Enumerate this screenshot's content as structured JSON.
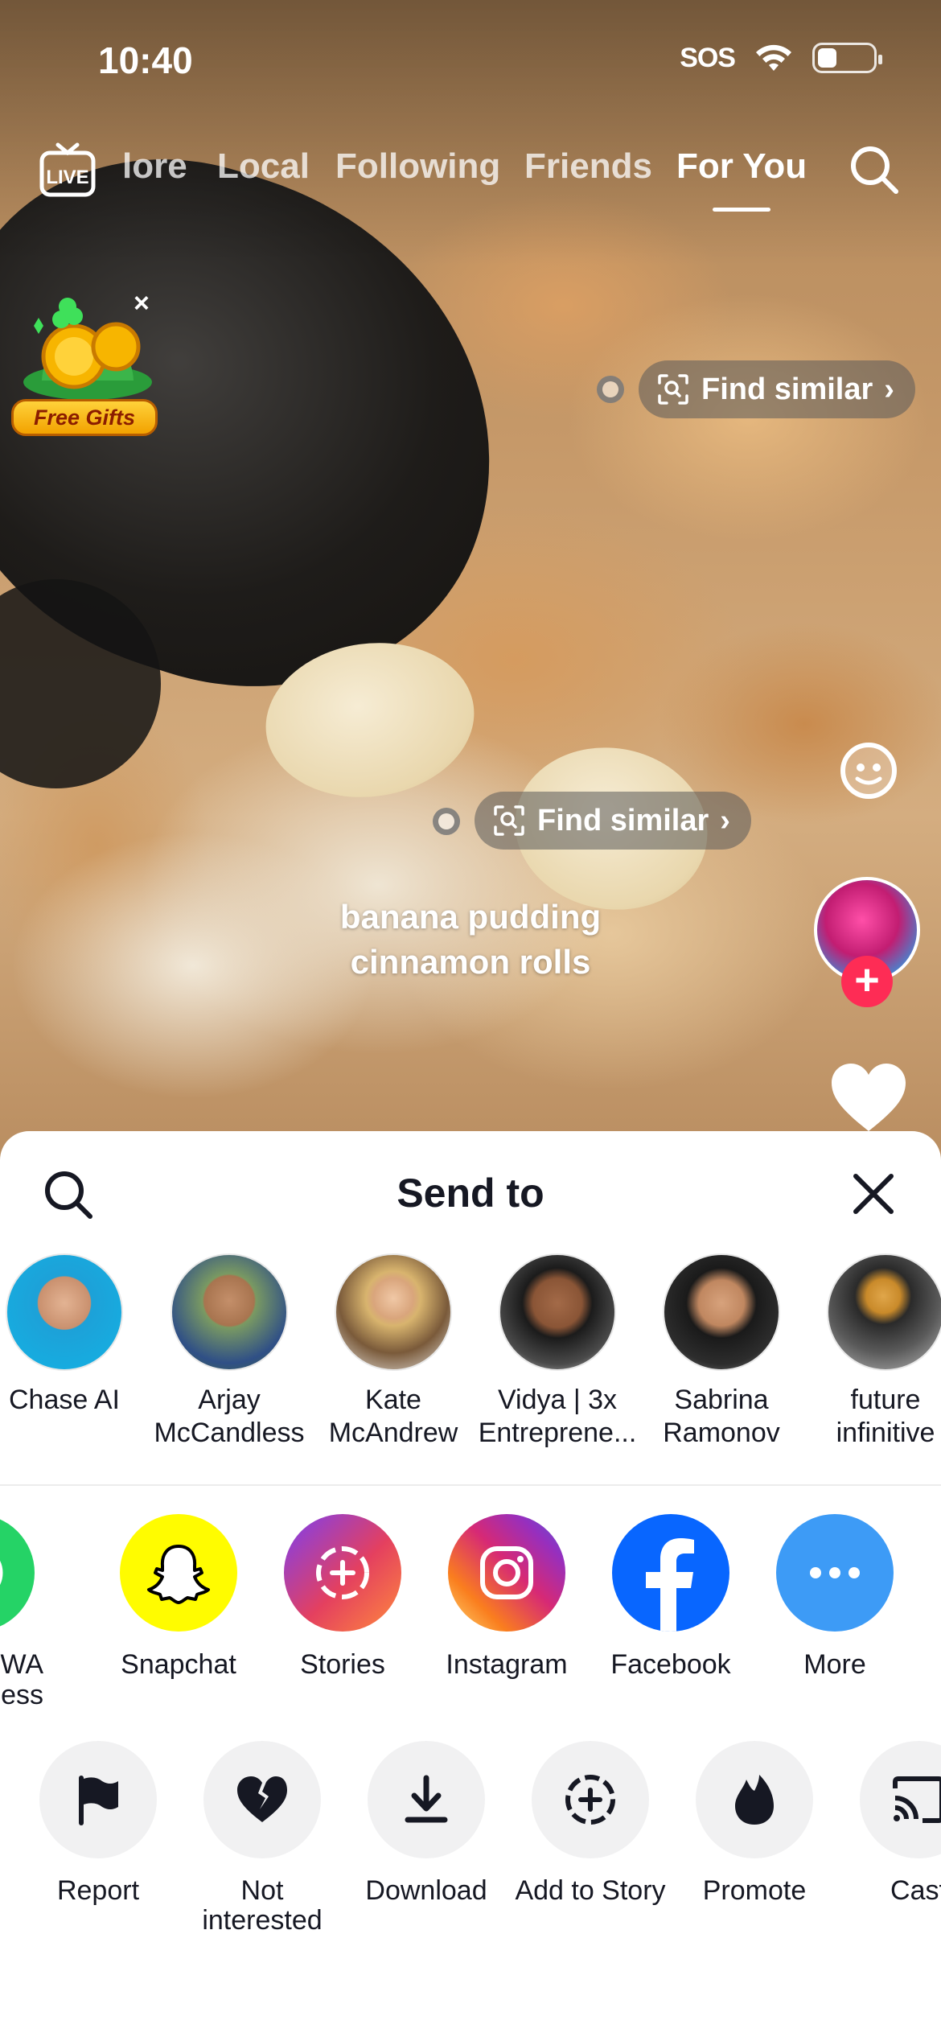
{
  "status_bar": {
    "time": "10:40",
    "sos": "SOS",
    "battery_level_fraction": 0.35
  },
  "top_nav": {
    "live_label": "LIVE",
    "tabs": [
      {
        "label": "lore",
        "active": false
      },
      {
        "label": "Local",
        "active": false
      },
      {
        "label": "Following",
        "active": false
      },
      {
        "label": "Friends",
        "active": false
      },
      {
        "label": "For You",
        "active": true
      }
    ],
    "search_icon": "search-icon"
  },
  "promo": {
    "label": "Free Gifts",
    "close": "×"
  },
  "video": {
    "find_similar_label": "Find similar",
    "caption_line1": "banana pudding",
    "caption_line2": "cinnamon rolls"
  },
  "rail": {
    "follow_plus": "+"
  },
  "share_sheet": {
    "title": "Send to",
    "contacts": [
      {
        "name_line1": "Chase AI",
        "name_line2": ""
      },
      {
        "name_line1": "Arjay",
        "name_line2": "McCandless"
      },
      {
        "name_line1": "Kate",
        "name_line2": "McAndrew"
      },
      {
        "name_line1": "Vidya | 3x",
        "name_line2": "Entreprene..."
      },
      {
        "name_line1": "Sabrina",
        "name_line2": "Ramonov"
      },
      {
        "name_line1": "future",
        "name_line2": "infinitive"
      }
    ],
    "apps": [
      {
        "line1": "WA",
        "line2": "siness",
        "icon": "whatsapp-business-icon",
        "color": "#25d366"
      },
      {
        "line1": "Snapchat",
        "line2": "",
        "icon": "snapchat-icon",
        "color": "#fffc00"
      },
      {
        "line1": "Stories",
        "line2": "",
        "icon": "stories-icon",
        "color": "#e4405f"
      },
      {
        "line1": "Instagram",
        "line2": "",
        "icon": "instagram-icon",
        "color": "#dd2a7b"
      },
      {
        "line1": "Facebook",
        "line2": "",
        "icon": "facebook-icon",
        "color": "#0866ff"
      },
      {
        "line1": "More",
        "line2": "",
        "icon": "more-icon",
        "color": "#3d9bf6"
      }
    ],
    "actions": [
      {
        "line1": "Report",
        "line2": "",
        "icon": "flag-icon"
      },
      {
        "line1": "Not",
        "line2": "interested",
        "icon": "broken-heart-icon"
      },
      {
        "line1": "Download",
        "line2": "",
        "icon": "download-icon"
      },
      {
        "line1": "Add to Story",
        "line2": "",
        "icon": "add-story-icon"
      },
      {
        "line1": "Promote",
        "line2": "",
        "icon": "flame-icon"
      },
      {
        "line1": "Cast",
        "line2": "",
        "icon": "cast-icon"
      }
    ]
  }
}
